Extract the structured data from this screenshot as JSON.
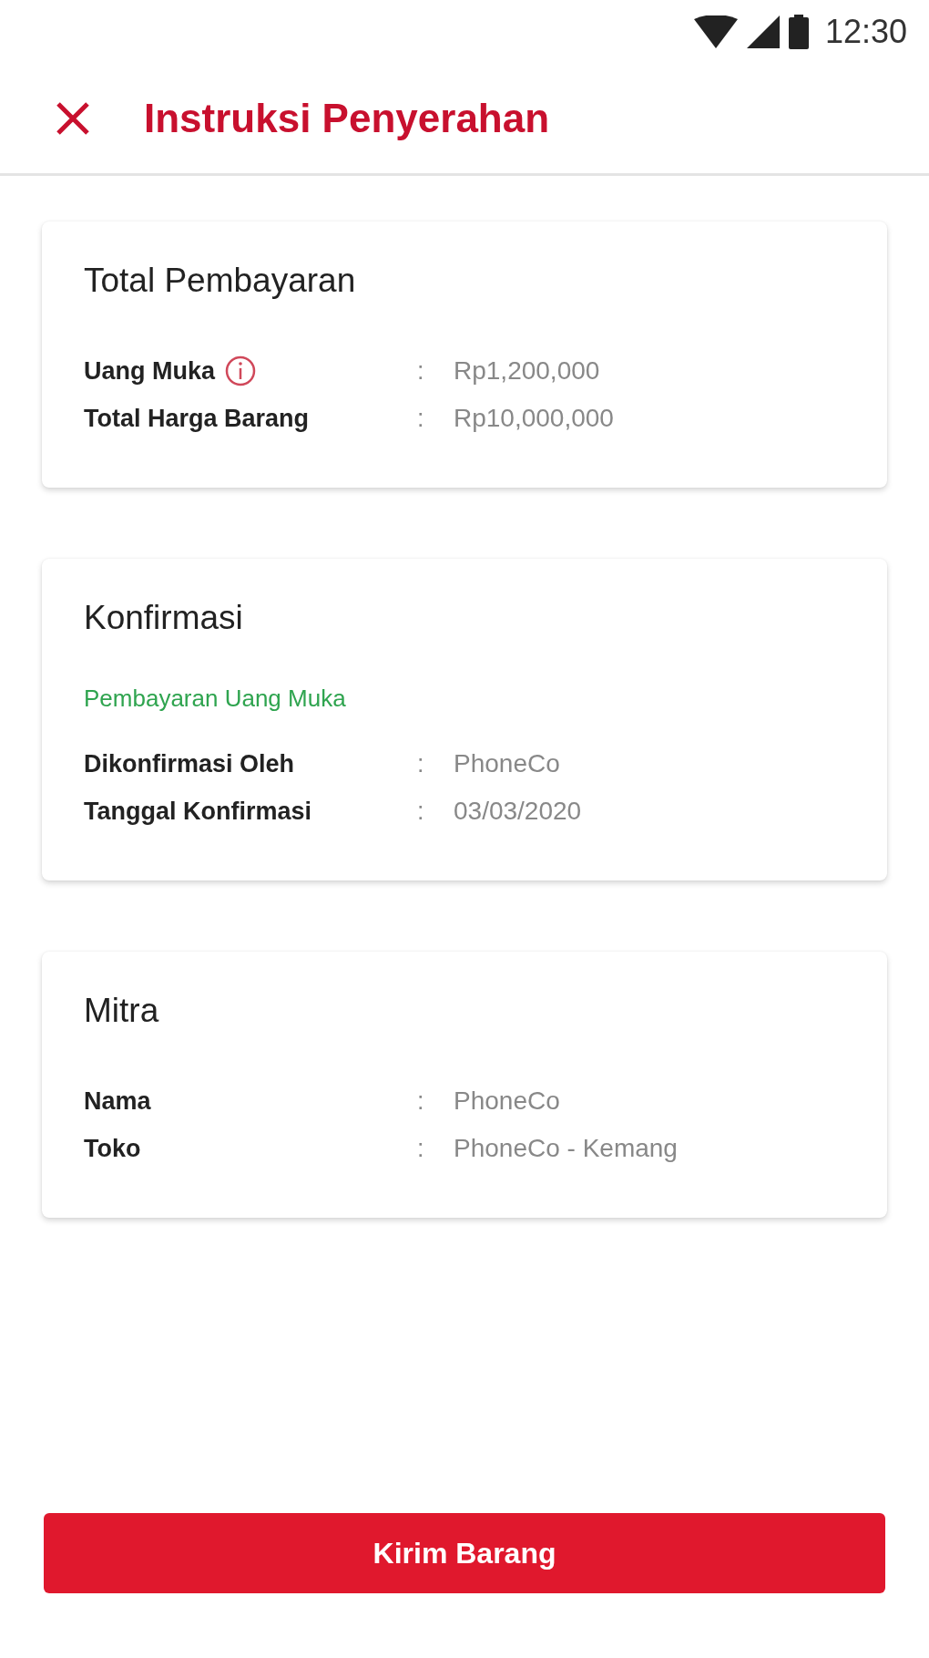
{
  "status_bar": {
    "time": "12:30"
  },
  "app_bar": {
    "title": "Instruksi Penyerahan"
  },
  "cards": [
    {
      "title": "Total Pembayaran",
      "rows": [
        {
          "label": "Uang Muka",
          "info_icon": true,
          "colon": ":",
          "value": "Rp1,200,000"
        },
        {
          "label": "Total Harga Barang",
          "info_icon": false,
          "colon": ":",
          "value": "Rp10,000,000"
        }
      ]
    },
    {
      "title": "Konfirmasi",
      "status": "Pembayaran Uang Muka",
      "rows": [
        {
          "label": "Dikonfirmasi Oleh",
          "info_icon": false,
          "colon": ":",
          "value": "PhoneCo"
        },
        {
          "label": "Tanggal Konfirmasi",
          "info_icon": false,
          "colon": ":",
          "value": "03/03/2020"
        }
      ]
    },
    {
      "title": "Mitra",
      "rows": [
        {
          "label": "Nama",
          "info_icon": false,
          "colon": ":",
          "value": "PhoneCo"
        },
        {
          "label": "Toko",
          "info_icon": false,
          "colon": ":",
          "value": "PhoneCo - Kemang"
        }
      ]
    }
  ],
  "primary_button": {
    "label": "Kirim Barang"
  }
}
